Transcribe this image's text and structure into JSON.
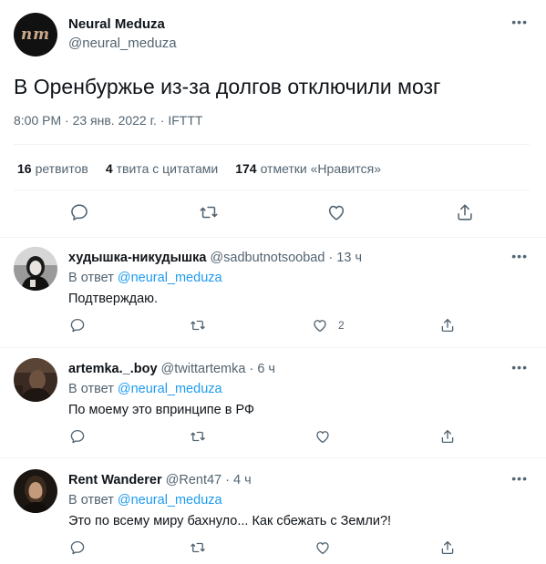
{
  "main_tweet": {
    "avatar_text": "nm",
    "author_name": "Neural Meduza",
    "author_handle": "@neural_meduza",
    "more_label": "•••",
    "text": "В Оренбуржье из-за долгов отключили мозг",
    "meta": "8:00 PM · 23 янв. 2022 г. · IFTTT",
    "stats": {
      "retweets_count": "16",
      "retweets_label": "ретвитов",
      "quotes_count": "4",
      "quotes_label": "твита с цитатами",
      "likes_count": "174",
      "likes_label": "отметки «Нравится»"
    },
    "actions": [
      "reply-icon",
      "retweet-icon",
      "like-icon",
      "share-icon"
    ]
  },
  "replies": [
    {
      "name": "худышка-никудышка",
      "rest": " @sadbutnotsoobad · 13 ч",
      "in_reply_prefix": "В ответ ",
      "in_reply_mention": "@neural_meduza",
      "text": "Подтверждаю.",
      "like_count": "2",
      "more_label": "•••"
    },
    {
      "name": "artemka._.boy",
      "rest": " @twittartemka · 6 ч",
      "in_reply_prefix": "В ответ ",
      "in_reply_mention": "@neural_meduza",
      "text": "По моему это впринципе в РФ",
      "like_count": "",
      "more_label": "•••"
    },
    {
      "name": "Rent Wanderer",
      "rest": " @Rent47 · 4 ч",
      "in_reply_prefix": "В ответ ",
      "in_reply_mention": "@neural_meduza",
      "text": "Это по всему миру бахнуло... Как сбежать с Земли?!",
      "like_count": "",
      "more_label": "•••"
    }
  ],
  "colors": {
    "text_primary": "#0f1419",
    "text_secondary": "#536471",
    "mention": "#1d9bf0",
    "divider": "#eff3f4"
  }
}
